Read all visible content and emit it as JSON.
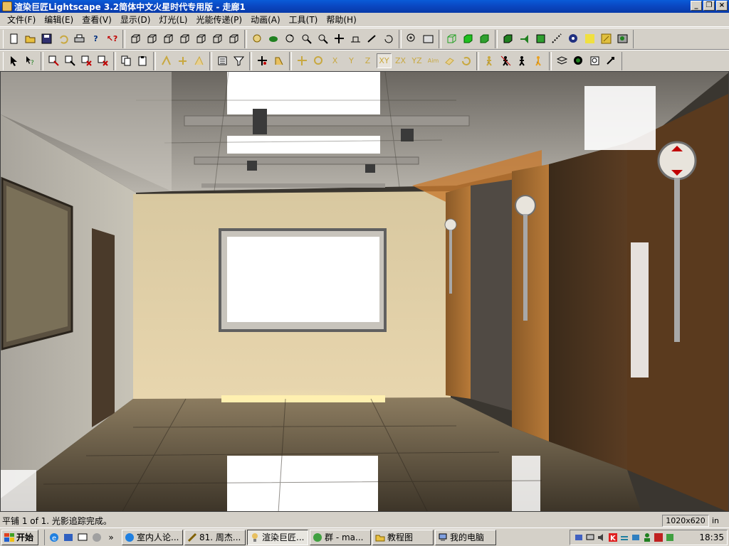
{
  "window": {
    "title": "渲染巨匠Lightscape 3.2简体中文火星时代专用版 - 走廊1",
    "minimize_label": "_",
    "restore_label": "❐",
    "close_label": "×"
  },
  "menu": [
    {
      "label": "文件(F)"
    },
    {
      "label": "编辑(E)"
    },
    {
      "label": "查看(V)"
    },
    {
      "label": "显示(D)"
    },
    {
      "label": "灯光(L)"
    },
    {
      "label": "光能传递(P)"
    },
    {
      "label": "动画(A)"
    },
    {
      "label": "工具(T)"
    },
    {
      "label": "帮助(H)"
    }
  ],
  "toolbar1": {
    "file_group": [
      "new-icon",
      "open-icon",
      "save-icon",
      "undo-icon",
      "print-icon",
      "help-icon",
      "context-help-icon"
    ],
    "view_cube_group": [
      "view-top-icon",
      "view-front-icon",
      "view-left-icon",
      "view-right-icon",
      "view-back-icon",
      "view-bottom-icon",
      "view-perspective-icon"
    ],
    "navigation_group": [
      "camera-icon",
      "walk-icon",
      "orbit-icon",
      "zoom-icon",
      "zoom-window-icon",
      "pan-icon",
      "dolly-icon",
      "roll-icon",
      "rotate-icon"
    ],
    "zoom_group": [
      "zoom-extents-icon",
      "zoom-selected-icon"
    ],
    "display_group": [
      "wireframe-icon",
      "solid-icon",
      "shaded-icon"
    ],
    "render_group": [
      "object-icon",
      "light-icon",
      "material-icon",
      "texture-icon",
      "layer-icon",
      "sun-icon",
      "render-icon"
    ]
  },
  "toolbar2": {
    "select_group": [
      "select-arrow-icon",
      "select-help-icon"
    ],
    "select_mode_group": [
      "select-window-icon",
      "select-add-icon",
      "select-remove-icon",
      "select-clear-icon"
    ],
    "edit_group": [
      "copy-icon",
      "paste-icon"
    ],
    "transform_group": [
      "align-icon",
      "snap-icon",
      "group-icon"
    ],
    "property_group": [
      "property-icon",
      "filter-icon"
    ],
    "axis_group": [
      "add-vertex-icon",
      "move-vertex-icon"
    ],
    "constraint_group": [
      "move-icon",
      "rotate-free-icon",
      "x-axis-icon",
      "y-axis-icon",
      "z-axis-icon",
      "xy-plane-icon",
      "zx-plane-icon",
      "yz-plane-icon",
      "aim-icon",
      "scale-icon",
      "reset-icon"
    ],
    "animation_group": [
      "walk-person-icon",
      "walk-path-icon",
      "run-icon",
      "figure-icon"
    ],
    "misc_group": [
      "layers-icon",
      "record-icon",
      "refresh-icon",
      "export-icon"
    ],
    "axis_labels": {
      "x": "X",
      "y": "Y",
      "z": "Z",
      "xy": "XY",
      "zx": "ZX",
      "yz": "YZ",
      "aim": "Aim"
    }
  },
  "statusbar": {
    "message": "平铺 1 of 1. 光影追踪完成。",
    "resolution": "1020x620",
    "unit": "in"
  },
  "taskbar": {
    "start_label": "开始",
    "more_label": "»",
    "tasks": [
      {
        "label": "室内人论...",
        "icon": "ie-icon",
        "active": false
      },
      {
        "label": "81. 周杰...",
        "icon": "player-icon",
        "active": false
      },
      {
        "label": "渲染巨匠...",
        "icon": "lightscape-icon",
        "active": true
      },
      {
        "label": "群 - ma...",
        "icon": "chat-icon",
        "active": false
      },
      {
        "label": "教程图",
        "icon": "folder-icon",
        "active": false
      },
      {
        "label": "我的电脑",
        "icon": "computer-icon",
        "active": false
      }
    ],
    "tray_icons": [
      "network-icon",
      "monitor-icon",
      "volume-icon",
      "k-icon",
      "update-icon",
      "messenger-icon",
      "person-icon",
      "security-icon",
      "calendar-icon"
    ],
    "clock": "18:35"
  },
  "colors": {
    "titlebar": "#0a46c0",
    "chrome": "#d4d0c8",
    "toolbar_icon_yellow": "#c8a840"
  }
}
